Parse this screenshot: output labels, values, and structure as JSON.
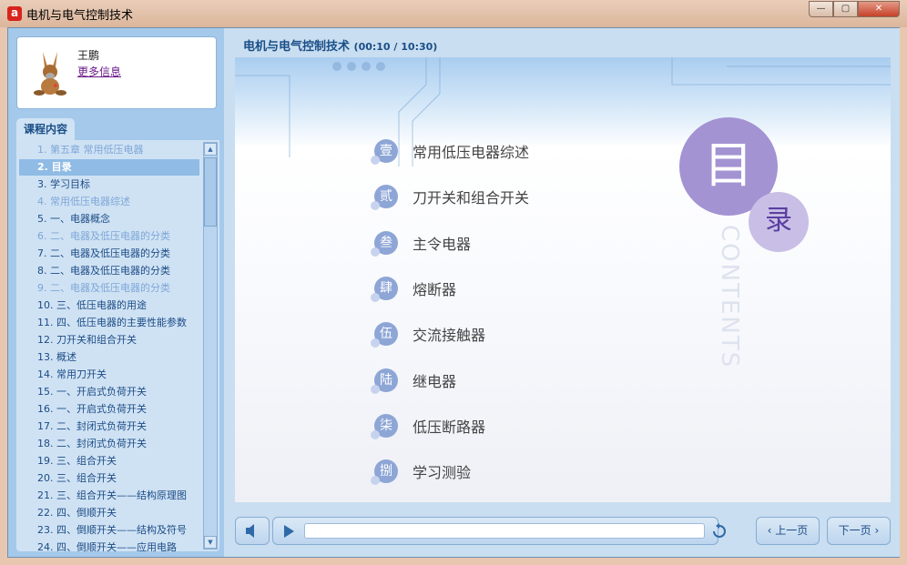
{
  "window": {
    "title": "电机与电气控制技术",
    "icon": "app-a-icon",
    "buttons": [
      "minimize",
      "maximize",
      "close"
    ]
  },
  "profile": {
    "name": "王鹏",
    "more_link": "更多信息",
    "avatar": "donkey-avatar"
  },
  "sidebar": {
    "tab": "课程内容",
    "selected_index": 1,
    "items": [
      {
        "label": "1. 第五章 常用低压电器",
        "dim": true
      },
      {
        "label": "2. 目录",
        "dim": false
      },
      {
        "label": "3. 学习目标",
        "dim": false
      },
      {
        "label": "4. 常用低压电器综述",
        "dim": true
      },
      {
        "label": "5. 一、电器概念",
        "dim": false
      },
      {
        "label": "6. 二、电器及低压电器的分类",
        "dim": true
      },
      {
        "label": "7. 二、电器及低压电器的分类",
        "dim": false
      },
      {
        "label": "8. 二、电器及低压电器的分类",
        "dim": false
      },
      {
        "label": "9. 二、电器及低压电器的分类",
        "dim": true
      },
      {
        "label": "10. 三、低压电器的用途",
        "dim": false
      },
      {
        "label": "11. 四、低压电器的主要性能参数",
        "dim": false
      },
      {
        "label": "12. 刀开关和组合开关",
        "dim": false
      },
      {
        "label": "13. 概述",
        "dim": false
      },
      {
        "label": "14. 常用刀开关",
        "dim": false
      },
      {
        "label": "15. 一、开启式负荷开关",
        "dim": false
      },
      {
        "label": "16. 一、开启式负荷开关",
        "dim": false
      },
      {
        "label": "17. 二、封闭式负荷开关",
        "dim": false
      },
      {
        "label": "18. 二、封闭式负荷开关",
        "dim": false
      },
      {
        "label": "19. 三、组合开关",
        "dim": false
      },
      {
        "label": "20. 三、组合开关",
        "dim": false
      },
      {
        "label": "21. 三、组合开关——结构原理图",
        "dim": false
      },
      {
        "label": "22. 四、倒顺开关",
        "dim": false
      },
      {
        "label": "23. 四、倒顺开关——结构及符号",
        "dim": false
      },
      {
        "label": "24. 四、倒顺开关——应用电路",
        "dim": false
      }
    ]
  },
  "header": {
    "title": "电机与电气控制技术",
    "time": "(00:10 / 10:30)"
  },
  "slide": {
    "mu": "目",
    "lu": "录",
    "contents": "CONTENTS",
    "items": [
      {
        "num": "壹",
        "text": "常用低压电器综述"
      },
      {
        "num": "贰",
        "text": "刀开关和组合开关"
      },
      {
        "num": "叁",
        "text": "主令电器"
      },
      {
        "num": "肆",
        "text": "熔断器"
      },
      {
        "num": "伍",
        "text": "交流接触器"
      },
      {
        "num": "陆",
        "text": "继电器"
      },
      {
        "num": "柒",
        "text": "低压断路器"
      },
      {
        "num": "捌",
        "text": "学习测验"
      }
    ]
  },
  "controls": {
    "prev": "上一页",
    "next": "下一页",
    "progress": 0.016,
    "icons": [
      "volume-icon",
      "play-icon",
      "replay-icon"
    ]
  }
}
